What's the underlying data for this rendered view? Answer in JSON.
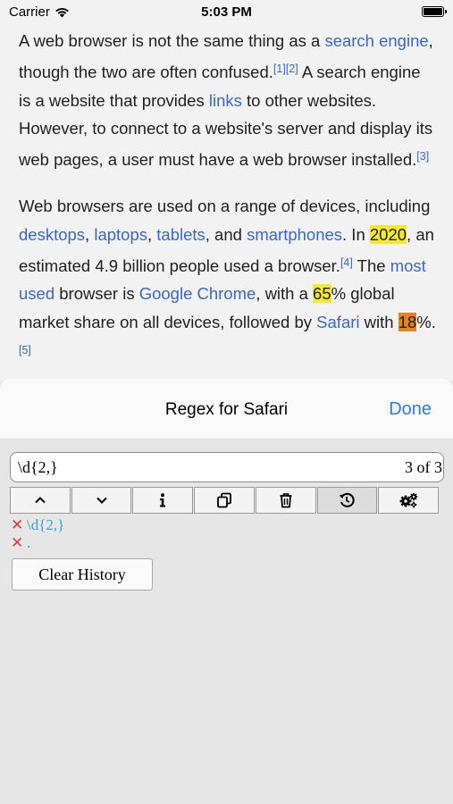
{
  "status": {
    "carrier": "Carrier",
    "time": "5:03 PM"
  },
  "article": {
    "p1": [
      {
        "t": "A web browser is not the same thing as a ",
        "k": "text"
      },
      {
        "t": "search engine",
        "k": "link"
      },
      {
        "t": ", though the two are often confused.",
        "k": "text"
      },
      {
        "t": "[1]",
        "k": "ref"
      },
      {
        "t": "[2]",
        "k": "ref"
      },
      {
        "t": " A search engine is a website that provides ",
        "k": "text"
      },
      {
        "t": "links",
        "k": "link"
      },
      {
        "t": " to other websites. However, to connect to a website's server and display its web pages, a user must have a web browser installed.",
        "k": "text"
      },
      {
        "t": "[3]",
        "k": "ref"
      }
    ],
    "p2": [
      {
        "t": "Web browsers are used on a range of devices, including ",
        "k": "text"
      },
      {
        "t": "desktops",
        "k": "link"
      },
      {
        "t": ", ",
        "k": "text"
      },
      {
        "t": "laptops",
        "k": "link"
      },
      {
        "t": ", ",
        "k": "text"
      },
      {
        "t": "tablets",
        "k": "link"
      },
      {
        "t": ", and ",
        "k": "text"
      },
      {
        "t": "smartphones",
        "k": "link"
      },
      {
        "t": ". In ",
        "k": "text"
      },
      {
        "t": "2020",
        "k": "match"
      },
      {
        "t": ", an estimated 4.9 billion people used a browser.",
        "k": "text"
      },
      {
        "t": "[4]",
        "k": "ref"
      },
      {
        "t": " The ",
        "k": "text"
      },
      {
        "t": "most used",
        "k": "link"
      },
      {
        "t": " browser is ",
        "k": "text"
      },
      {
        "t": "Google Chrome",
        "k": "link"
      },
      {
        "t": ", with a ",
        "k": "text"
      },
      {
        "t": "65",
        "k": "match"
      },
      {
        "t": "% global market share on all devices, followed by ",
        "k": "text"
      },
      {
        "t": "Safari",
        "k": "link"
      },
      {
        "t": " with ",
        "k": "text"
      },
      {
        "t": "18",
        "k": "current-match"
      },
      {
        "t": "%.",
        "k": "text"
      },
      {
        "t": "[5]",
        "k": "ref"
      }
    ]
  },
  "sheet": {
    "title": "Regex for Safari",
    "done_label": "Done",
    "search": {
      "value": "\\d{2,}",
      "match_count": "3 of 3"
    },
    "toolbar": [
      {
        "name": "previous-match-button",
        "icon": "chevron-up-icon"
      },
      {
        "name": "next-match-button",
        "icon": "chevron-down-icon"
      },
      {
        "name": "info-button",
        "icon": "info-icon"
      },
      {
        "name": "copy-button",
        "icon": "copy-icon"
      },
      {
        "name": "delete-button",
        "icon": "trash-icon"
      },
      {
        "name": "history-button",
        "icon": "history-icon",
        "active": true
      },
      {
        "name": "settings-button",
        "icon": "gears-icon"
      }
    ],
    "history": [
      "\\d{2,}",
      "."
    ],
    "clear_history_label": "Clear History"
  },
  "colors": {
    "link": "#3b66c4",
    "match_highlight": "#f4ea2a",
    "current_match_highlight": "#e9821d",
    "done": "#2f7ae5",
    "history_delete": "#d63a3a",
    "history_text": "#3aa0d8"
  }
}
